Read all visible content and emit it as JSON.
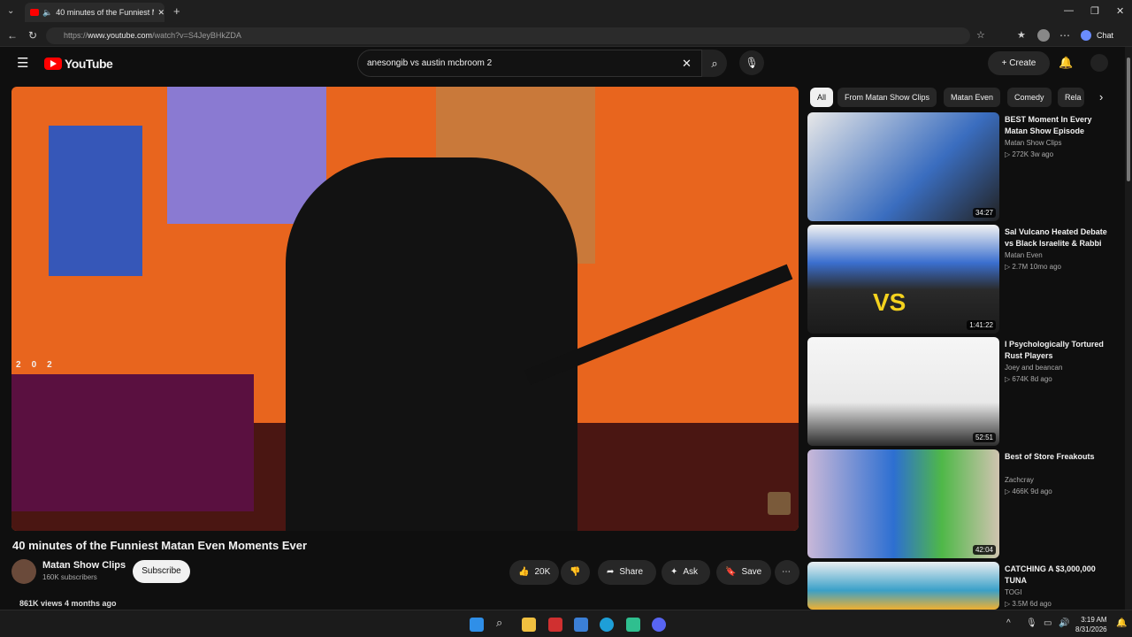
{
  "browser": {
    "tab_title": "40 minutes of the Funniest M",
    "url_prefix": "https://",
    "url_host": "www.youtube.com",
    "url_path": "/watch?v=S4JeyBHkZDA",
    "chat_label": "Chat"
  },
  "header": {
    "logo_text": "YouTube",
    "search_query": "anesongib vs austin mcbroom 2",
    "create_label": "Create"
  },
  "player": {
    "stats": [
      {
        "value": "2"
      },
      {
        "value": "0"
      },
      {
        "value": "2"
      }
    ]
  },
  "video": {
    "title": "40 minutes of the Funniest Matan Even Moments Ever",
    "channel": "Matan Show Clips",
    "subscribers": "160K subscribers",
    "subscribe_label": "Subscribe",
    "likes": "20K",
    "share_label": "Share",
    "ask_label": "Ask",
    "save_label": "Save",
    "views_line": "861K views  4 months ago"
  },
  "chips": [
    "All",
    "From Matan Show Clips",
    "Matan Even",
    "Comedy",
    "Rela"
  ],
  "recommendations": [
    {
      "title": "BEST Moment In Every Matan Show Episode",
      "channel": "Matan Show Clips",
      "meta": "▷ 272K  3w ago",
      "duration": "34:27"
    },
    {
      "title": "Sal Vulcano Heated Debate vs Black Israelite & Rabbi",
      "channel": "Matan Even",
      "meta": "▷ 2.7M  10mo ago",
      "duration": "1:41:22"
    },
    {
      "title": "I Psychologically Tortured Rust Players",
      "channel": "Joey and beancan",
      "meta": "▷ 674K  8d ago",
      "duration": "52:51"
    },
    {
      "title": "Best of Store Freakouts",
      "channel": "Zachcray",
      "meta": "▷ 466K  9d ago",
      "duration": "42:04"
    },
    {
      "title": "CATCHING A $3,000,000 TUNA",
      "channel": "TOGI",
      "meta": "▷ 3.5M  6d ago",
      "duration": ""
    }
  ],
  "taskbar": {
    "time": "3:19 AM",
    "date": "8/31/2026"
  }
}
